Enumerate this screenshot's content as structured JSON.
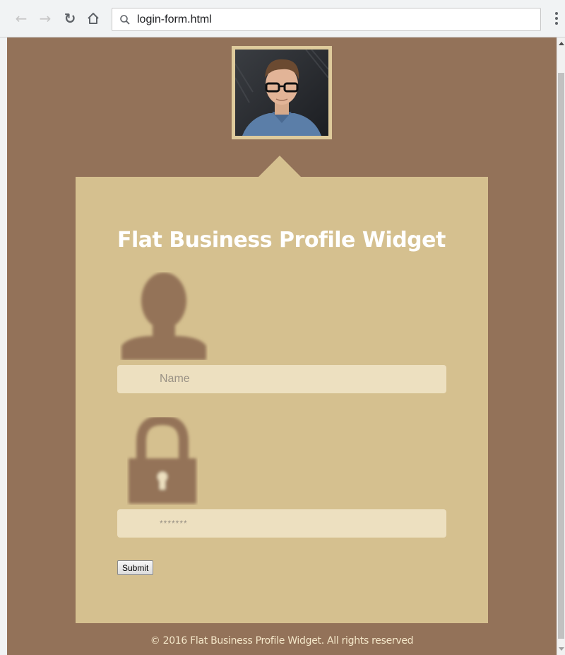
{
  "browser": {
    "url": "login-form.html",
    "icons": {
      "back": "arrow-left-icon",
      "forward": "arrow-right-icon",
      "reload": "reload-icon",
      "home": "home-icon",
      "search": "search-icon",
      "menu": "kebab-menu-icon"
    }
  },
  "widget": {
    "title": "Flat Business Profile Widget",
    "name_placeholder": "Name",
    "password_placeholder": "*******",
    "submit_label": "Submit"
  },
  "footer": {
    "text": "© 2016 Flat Business Profile Widget. All rights reserved"
  },
  "colors": {
    "page_background": "#937259",
    "card_background": "#d5c08f",
    "input_background": "#ede0c0",
    "icon_color": "#947359",
    "title_color": "#ffffff",
    "footer_text": "#f4e7c9"
  }
}
